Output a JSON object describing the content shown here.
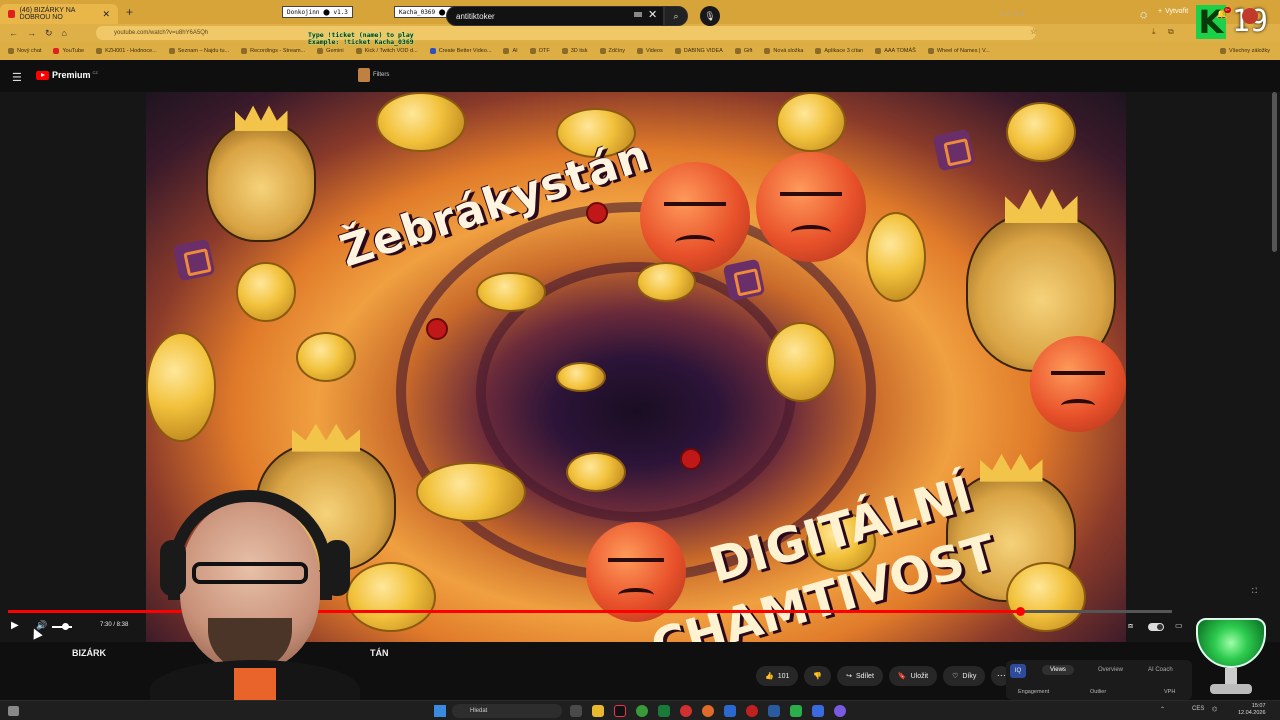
{
  "browser": {
    "tab_title": "(46) BIZÁRKY NA DOBROU NO",
    "tab_close": "✕",
    "new_tab": "+",
    "url": "youtube.com/watch?v=u8hY6A5Qh",
    "badges": [
      "Donkojinn ⬤ v1.3",
      "Kacha_0369 ⬤ v1.3"
    ],
    "bookmarks": [
      "Nový chat",
      "YouTube",
      "KZH001 - Hodnoce...",
      "Seznam – Najdu tu...",
      "Recordings - Stream...",
      "Gemini",
      "Kick / Twitch VOD d...",
      "Create Better Video...",
      "AI",
      "OTF",
      "3D tisk",
      "Zdčíny",
      "Videos",
      "DABING VIDEA",
      "Gift",
      "Nová složka",
      "Aplikace 3 cítan",
      "AAA TOMÁŠ",
      "Wheel of Names | V..."
    ],
    "bookmarks_right": "Všechny záložky"
  },
  "overlay": {
    "line1": "Type !ticket (name) to play",
    "line2": "Example: !ticket Kacha_0369",
    "counter_letter": "K",
    "counter_value": "19"
  },
  "youtube": {
    "logo_text": "Premium",
    "logo_region": "CZ",
    "filters_label": "Filters",
    "search_value": "antitiktoker",
    "create_label": "Vytvořit",
    "bell_badge": "9+",
    "ext_text": "0 0  0 0"
  },
  "thumbnail": {
    "title_top": "Žebrákystán",
    "title_bottom_line1": "DIGITÁLNÍ",
    "title_bottom_line2": "CHAMTIVOST"
  },
  "player": {
    "time": "7:30 / 8:38",
    "progress_fraction": 0.869,
    "volume_fraction": 0.65
  },
  "video_info": {
    "title_left": "BIZÁRK",
    "title_right": "TÁN",
    "like_count": "101",
    "share_label": "Sdílet",
    "save_label": "Uložit",
    "thanks_label": "Díky",
    "more": "⋯"
  },
  "panel": {
    "icon_text": "IQ",
    "tabs": [
      "Views",
      "Overview",
      "AI Coach"
    ],
    "labels": [
      "Engagement",
      "Outlier",
      "VPH"
    ]
  },
  "taskbar": {
    "search_placeholder": "Hledat",
    "lang": "CES",
    "time": "15:07",
    "date": "12.04.2026"
  }
}
